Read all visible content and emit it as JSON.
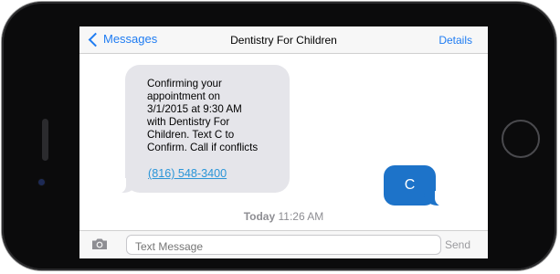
{
  "navbar": {
    "back_label": "Messages",
    "title": "Dentistry For Children",
    "details_label": "Details"
  },
  "incoming_message": {
    "lines": [
      "Confirming your",
      "appointment on",
      "3/1/2015 at 9:30 AM",
      "with Dentistry For",
      "Children. Text C to",
      "Confirm. Call if conflicts"
    ],
    "phone_link": "(816) 548-3400"
  },
  "outgoing_message": {
    "text": "C"
  },
  "timestamp": {
    "day": "Today",
    "time": "11:26 AM"
  },
  "input_bar": {
    "placeholder": "Text Message",
    "send_label": "Send"
  },
  "colors": {
    "accent": "#1f7cf2",
    "outgoing_bubble": "#1d73c9",
    "incoming_bubble": "#e5e5ea",
    "link": "#2a95d8"
  }
}
